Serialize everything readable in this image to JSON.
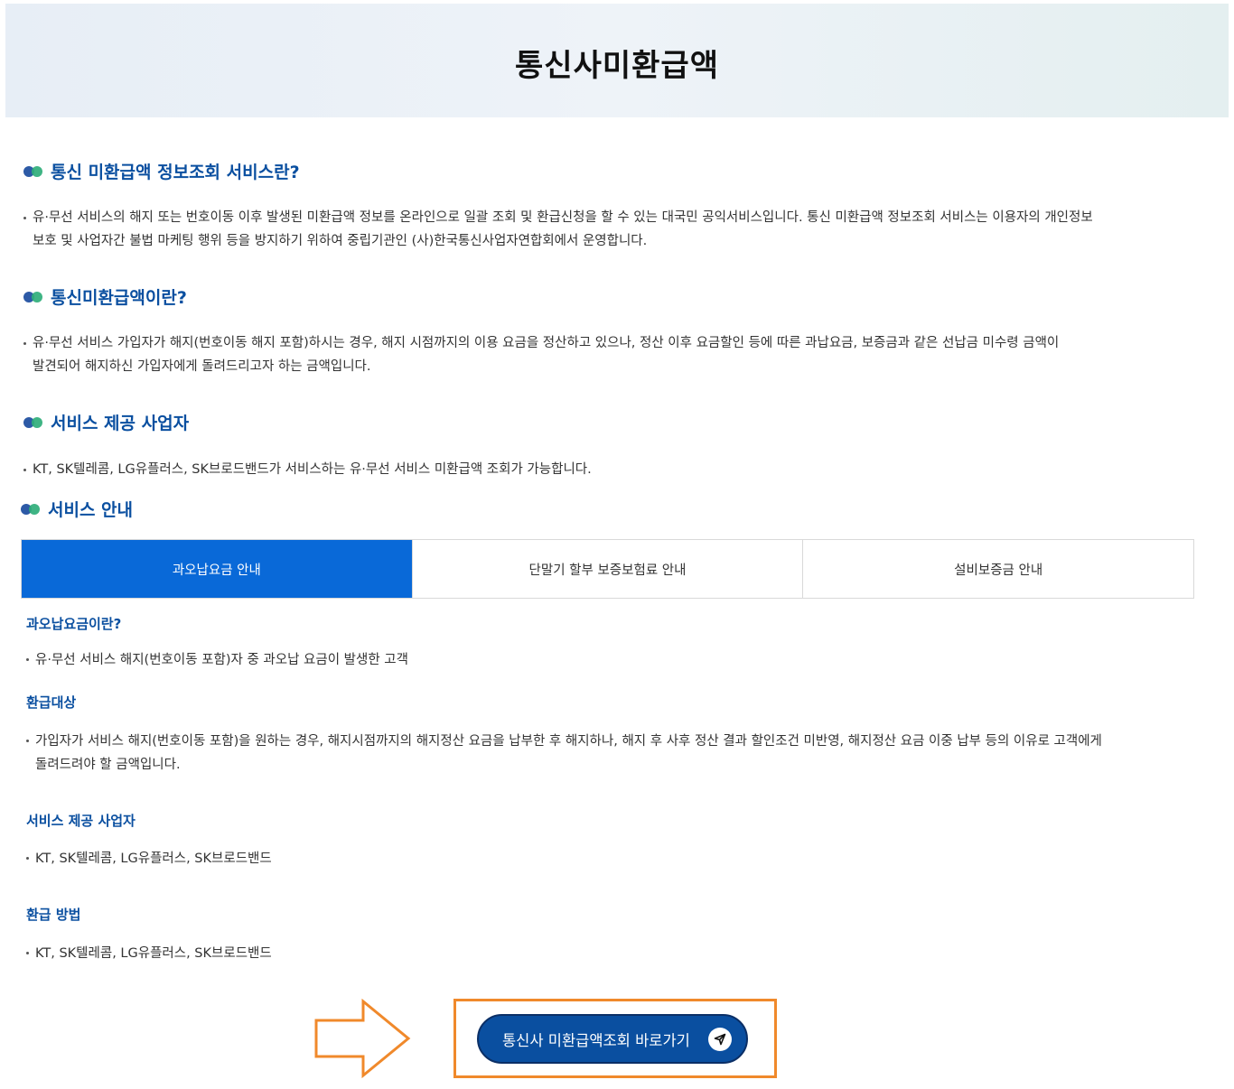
{
  "page_title": "통신사미환급액",
  "sections": [
    {
      "title": "통신 미환급액 정보조회 서비스란?",
      "lines": [
        "유·무선 서비스의 해지 또는 번호이동 이후 발생된 미환급액 정보를 온라인으로 일괄 조회 및 환급신청을 할 수 있는 대국민 공익서비스입니다. 통신 미환급액 정보조회 서비스는 이용자의 개인정보",
        "보호 및 사업자간 불법 마케팅 행위 등을 방지하기 위하여 중립기관인 (사)한국통신사업자연합회에서 운영합니다."
      ]
    },
    {
      "title": "통신미환급액이란?",
      "lines": [
        "유·무선 서비스 가입자가 해지(번호이동 해지 포함)하시는 경우, 해지 시점까지의 이용 요금을 정산하고 있으나, 정산 이후 요금할인 등에 따른 과납요금, 보증금과 같은 선납금 미수령 금액이",
        "발견되어 해지하신 가입자에게 돌려드리고자 하는 금액입니다."
      ]
    },
    {
      "title": "서비스 제공 사업자",
      "lines": [
        "KT, SK텔레콤, LG유플러스, SK브로드밴드가 서비스하는 유·무선 서비스 미환급액 조회가 가능합니다."
      ]
    },
    {
      "title": "서비스 안내",
      "lines": []
    }
  ],
  "tabs": [
    {
      "label": "과오납요금 안내",
      "active": true
    },
    {
      "label": "단말기 할부 보증보험료 안내",
      "active": false
    },
    {
      "label": "설비보증금 안내",
      "active": false
    }
  ],
  "tab_content": [
    {
      "title": "과오납요금이란?",
      "lines": [
        "유·무선 서비스 해지(번호이동 포함)자 중 과오납 요금이 발생한 고객"
      ]
    },
    {
      "title": "환급대상",
      "lines": [
        "가입자가 서비스 해지(번호이동 포함)을 원하는 경우, 해지시점까지의 해지정산 요금을 납부한 후 해지하나, 해지 후 사후 정산 결과 할인조건 미반영, 해지정산 요금 이중 납부 등의 이유로 고객에게",
        "돌려드려야 할 금액입니다."
      ]
    },
    {
      "title": "서비스 제공 사업자",
      "lines": [
        "KT, SK텔레콤, LG유플러스, SK브로드밴드"
      ]
    },
    {
      "title": "환급 방법",
      "lines": [
        "KT, SK텔레콤, LG유플러스, SK브로드밴드"
      ]
    }
  ],
  "cta": {
    "label": "통신사 미환급액조회 바로가기",
    "icon": "send-arrow-icon"
  },
  "colors": {
    "brand_blue": "#0a4fa0",
    "tab_active": "#0969d8",
    "highlight_orange": "#f0892b"
  }
}
